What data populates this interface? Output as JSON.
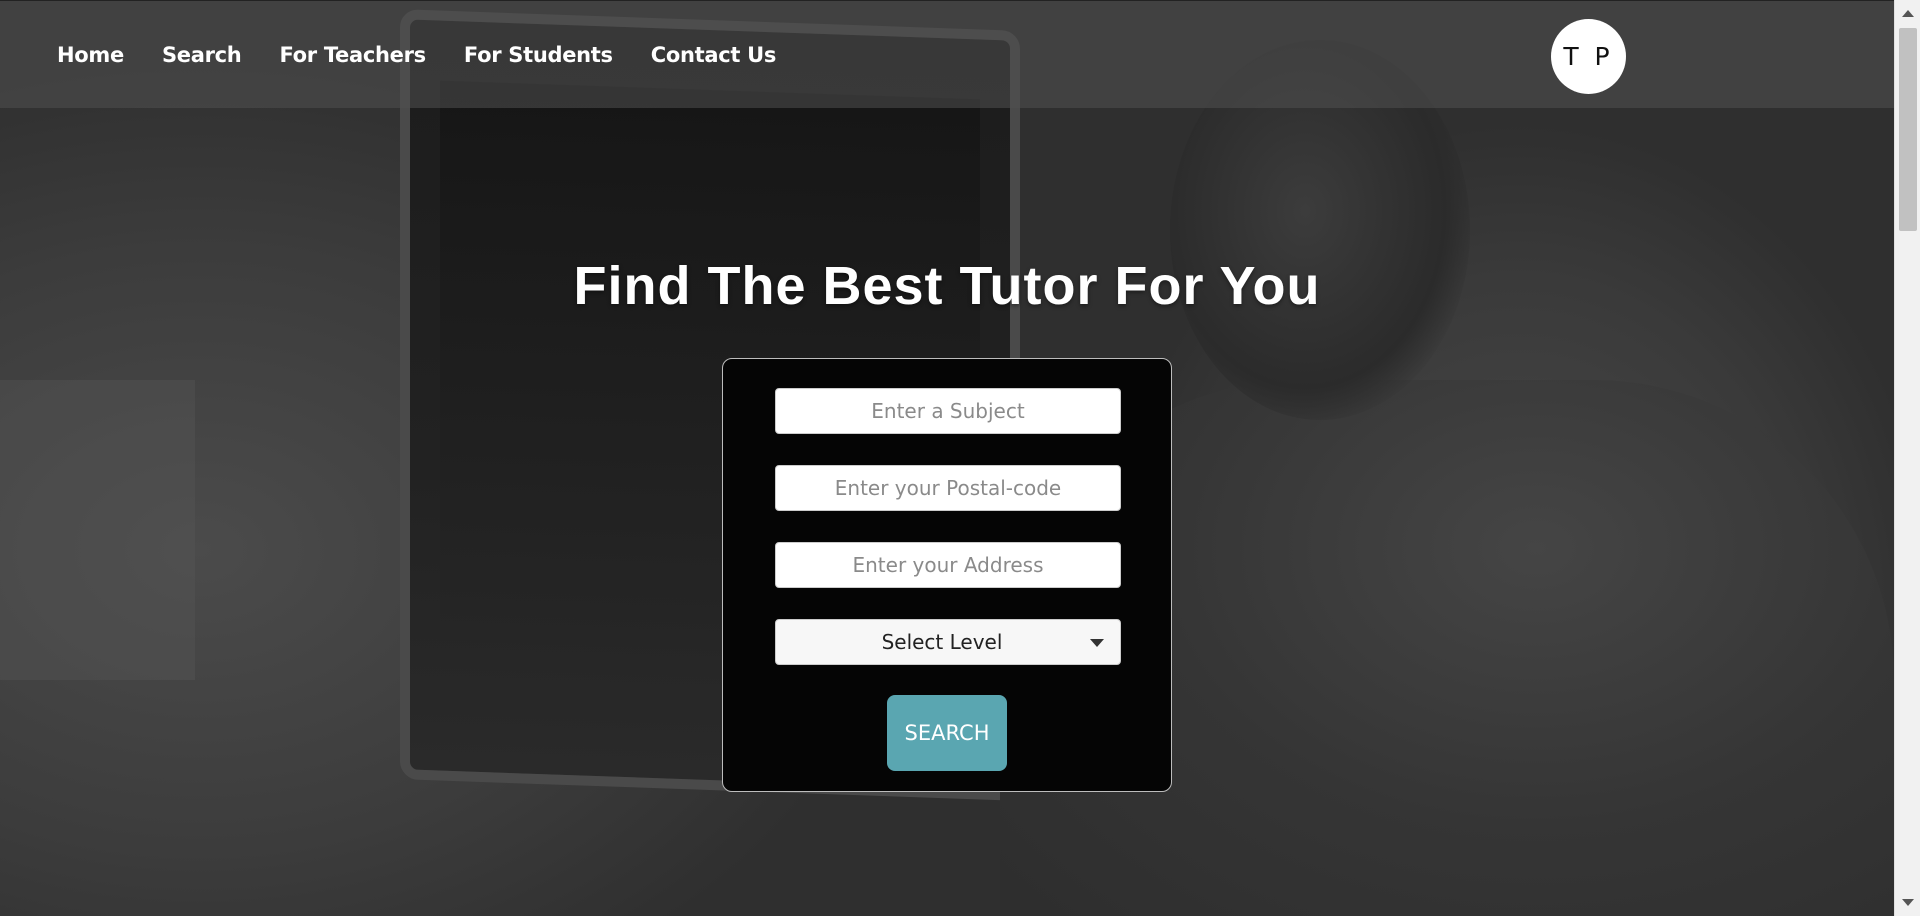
{
  "nav": {
    "items": [
      {
        "label": "Home"
      },
      {
        "label": "Search"
      },
      {
        "label": "For Teachers"
      },
      {
        "label": "For Students"
      },
      {
        "label": "Contact Us"
      }
    ],
    "logo_text": "T P"
  },
  "hero": {
    "title": "Find The Best Tutor For You"
  },
  "search_form": {
    "subject_placeholder": "Enter a Subject",
    "subject_value": "",
    "postal_placeholder": "Enter your Postal-code",
    "postal_value": "",
    "address_placeholder": "Enter your Address",
    "address_value": "",
    "level_selected": "Select Level",
    "submit_label": "SEARCH"
  },
  "colors": {
    "accent": "#5aa6b1",
    "card_bg": "#050505",
    "nav_bg": "#505050"
  },
  "icons": {
    "dropdown": "chevron-down-icon",
    "scroll_up": "arrow-up-icon",
    "scroll_down": "arrow-down-icon"
  }
}
